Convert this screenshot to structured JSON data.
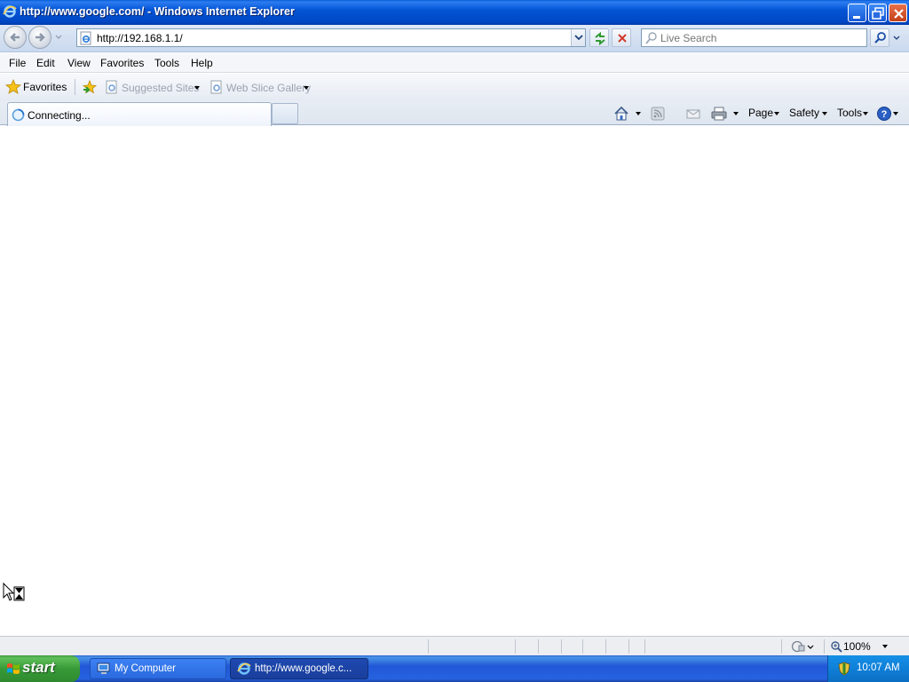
{
  "window": {
    "title": "http://www.google.com/ - Windows Internet Explorer"
  },
  "address_bar": {
    "url": "http://192.168.1.1/"
  },
  "search": {
    "placeholder": "Live Search"
  },
  "menu": {
    "items": [
      "File",
      "Edit",
      "View",
      "Favorites",
      "Tools",
      "Help"
    ]
  },
  "favorites_bar": {
    "favorites_label": "Favorites",
    "links": [
      "Suggested Sites",
      "Web Slice Gallery"
    ]
  },
  "tabs": [
    {
      "label": "Connecting..."
    }
  ],
  "command_bar": {
    "page_label": "Page",
    "safety_label": "Safety",
    "tools_label": "Tools"
  },
  "status_bar": {
    "zoom": "100%"
  },
  "taskbar": {
    "start_label": "start",
    "tasks": [
      {
        "label": "My Computer",
        "active": false
      },
      {
        "label": "http://www.google.c...",
        "active": true
      }
    ],
    "clock": "10:07 AM"
  },
  "colors": {
    "titlebar_blue": "#0355d6",
    "taskbar_blue": "#2157d7",
    "start_green": "#379a37",
    "tray_blue": "#0f7fd8"
  },
  "icons": [
    "ie-icon",
    "back-icon",
    "forward-icon",
    "refresh-icon",
    "stop-icon",
    "search-icon",
    "star-icon",
    "add-favorite-icon",
    "home-icon",
    "feeds-icon",
    "mail-icon",
    "print-icon",
    "help-icon",
    "hourglass-cursor-icon",
    "windows-flag-icon",
    "security-shield-icon",
    "zoom-icon"
  ]
}
